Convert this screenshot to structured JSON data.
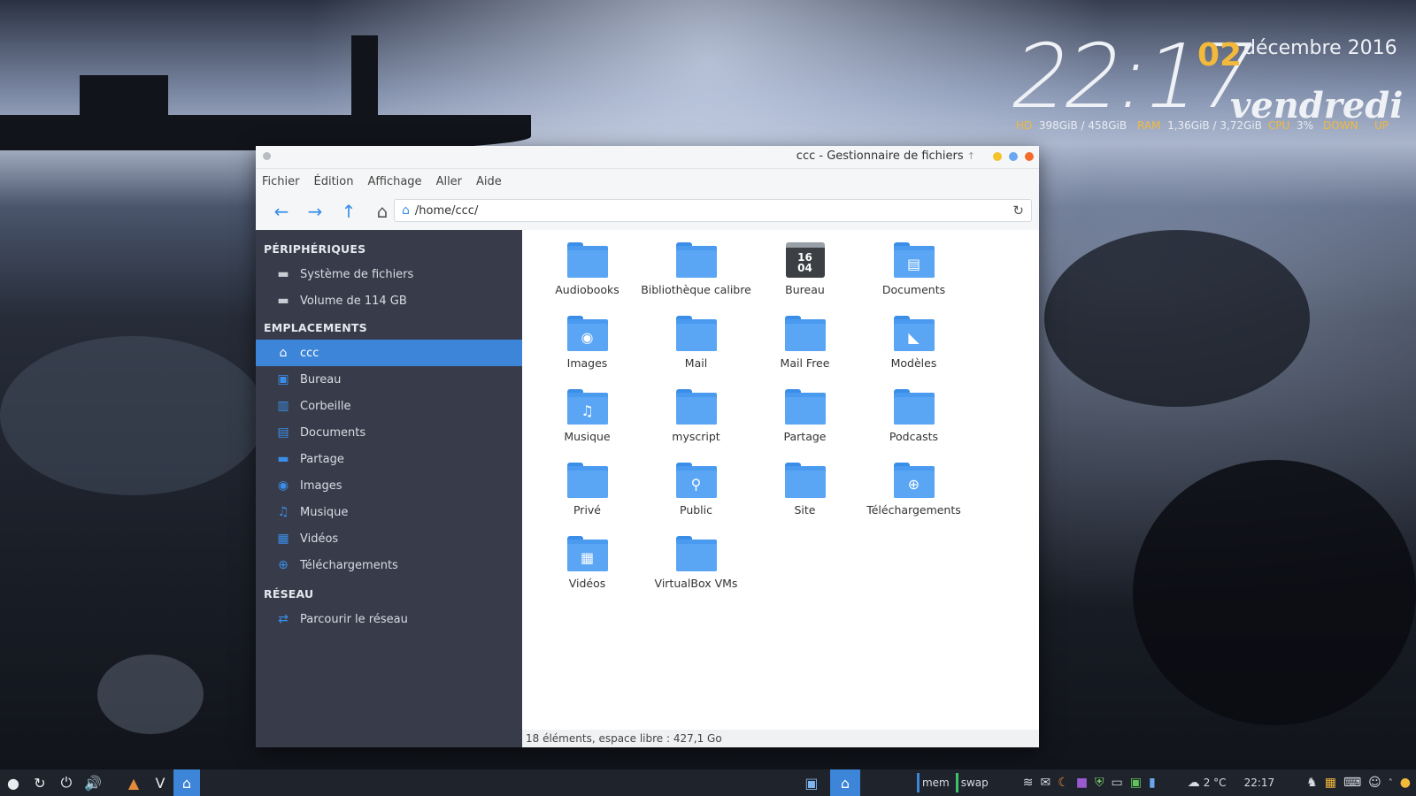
{
  "desktop": {
    "clock": {
      "hour_minute": "22:17",
      "day": "02",
      "month_year": "décembre 2016",
      "weekday": "vendredi"
    },
    "sysinfo": {
      "hd_label": "HD",
      "hd_value": "398GiB / 458GiB",
      "ram_label": "RAM",
      "ram_value": "1,36GiB / 3,72GiB",
      "cpu_label": "CPU",
      "cpu_value": "3%",
      "down_label": "DOWN",
      "up_label": "UP"
    }
  },
  "window": {
    "title": "ccc - Gestionnaire de fichiers",
    "title_suffix": "↑",
    "controls": {
      "minimize_color": "#f4c32c",
      "maximize_color": "#6aa7ef",
      "close_color": "#f46a2c"
    },
    "menu": [
      "Fichier",
      "Édition",
      "Affichage",
      "Aller",
      "Aide"
    ],
    "toolbar": {
      "back": "←",
      "forward": "→",
      "up": "↑",
      "home": "⌂"
    },
    "path": "/home/ccc/",
    "sidebar": {
      "devices_header": "PÉRIPHÉRIQUES",
      "devices": [
        {
          "label": "Système de fichiers",
          "icon": "drive-icon"
        },
        {
          "label": "Volume de 114 GB",
          "icon": "drive-icon"
        }
      ],
      "places_header": "EMPLACEMENTS",
      "places": [
        {
          "label": "ccc",
          "icon": "home-icon",
          "glyph": "⌂"
        },
        {
          "label": "Bureau",
          "icon": "desktop-icon",
          "glyph": "▣"
        },
        {
          "label": "Corbeille",
          "icon": "trash-icon",
          "glyph": "🗑"
        },
        {
          "label": "Documents",
          "icon": "documents-icon",
          "glyph": "▤"
        },
        {
          "label": "Partage",
          "icon": "folder-icon",
          "glyph": "▬"
        },
        {
          "label": "Images",
          "icon": "camera-icon",
          "glyph": "◉"
        },
        {
          "label": "Musique",
          "icon": "music-icon",
          "glyph": "♫"
        },
        {
          "label": "Vidéos",
          "icon": "film-icon",
          "glyph": "▦"
        },
        {
          "label": "Téléchargements",
          "icon": "download-icon",
          "glyph": "⊕"
        }
      ],
      "network_header": "RÉSEAU",
      "network": [
        {
          "label": "Parcourir le réseau",
          "icon": "network-icon",
          "glyph": "⇄"
        }
      ]
    },
    "files": [
      {
        "name": "Audiobooks",
        "icon": "folder-icon",
        "glyph": ""
      },
      {
        "name": "Bibliothèque calibre",
        "icon": "folder-icon",
        "glyph": ""
      },
      {
        "name": "Bureau",
        "icon": "calendar-icon",
        "cal_top": "16",
        "cal_bottom": "04"
      },
      {
        "name": "Documents",
        "icon": "folder-documents-icon",
        "glyph": "▤"
      },
      {
        "name": "Images",
        "icon": "folder-camera-icon",
        "glyph": "◉"
      },
      {
        "name": "Mail",
        "icon": "folder-icon",
        "glyph": ""
      },
      {
        "name": "Mail Free",
        "icon": "folder-icon",
        "glyph": ""
      },
      {
        "name": "Modèles",
        "icon": "folder-templates-icon",
        "glyph": "◣"
      },
      {
        "name": "Musique",
        "icon": "folder-music-icon",
        "glyph": "♫"
      },
      {
        "name": "myscript",
        "icon": "folder-icon",
        "glyph": ""
      },
      {
        "name": "Partage",
        "icon": "folder-icon",
        "glyph": ""
      },
      {
        "name": "Podcasts",
        "icon": "folder-icon",
        "glyph": ""
      },
      {
        "name": "Privé",
        "icon": "folder-icon",
        "glyph": ""
      },
      {
        "name": "Public",
        "icon": "folder-public-icon",
        "glyph": "⚲"
      },
      {
        "name": "Site",
        "icon": "folder-icon",
        "glyph": ""
      },
      {
        "name": "Téléchargements",
        "icon": "folder-download-icon",
        "glyph": "⊕"
      },
      {
        "name": "Vidéos",
        "icon": "folder-video-icon",
        "glyph": "▦"
      },
      {
        "name": "VirtualBox VMs",
        "icon": "folder-icon",
        "glyph": ""
      }
    ],
    "status": "18 éléments, espace libre : 427,1 Go"
  },
  "taskbar": {
    "mem_label": "mem",
    "swap_label": "swap",
    "weather": "2 °C",
    "time": "22:17"
  }
}
